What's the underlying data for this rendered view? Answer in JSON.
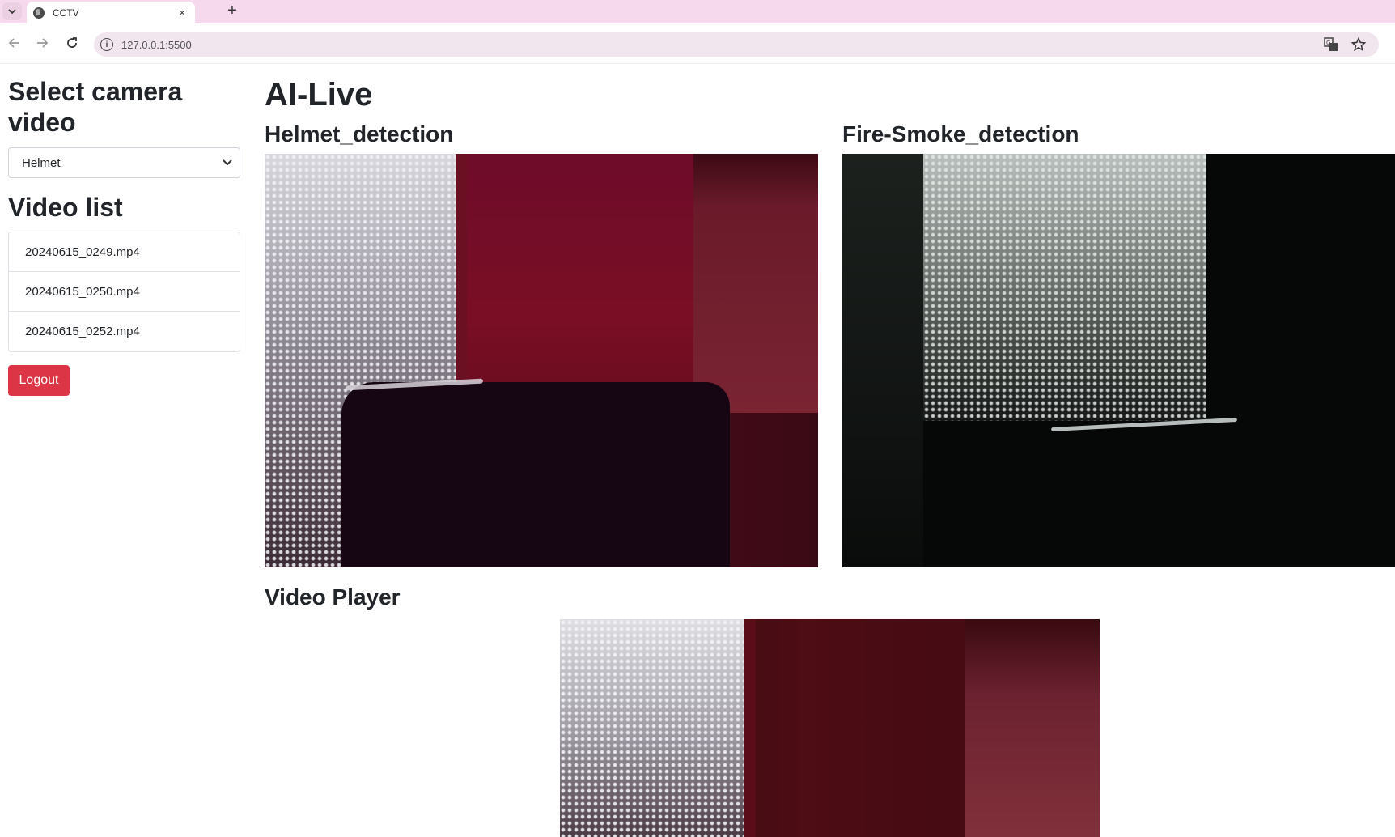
{
  "browser": {
    "tab_title": "CCTV",
    "tab_close": "×",
    "new_tab": "+",
    "url": "127.0.0.1:5500"
  },
  "sidebar": {
    "select_title": "Select camera video",
    "select_value": "Helmet",
    "list_title": "Video list",
    "videos": [
      "20240615_0249.mp4",
      "20240615_0250.mp4",
      "20240615_0252.mp4"
    ],
    "logout_label": "Logout",
    "logout_color": "#dc3545"
  },
  "main": {
    "title": "AI-Live",
    "feeds": [
      {
        "title": "Helmet_detection"
      },
      {
        "title": "Fire-Smoke_detection"
      }
    ],
    "player_title": "Video Player"
  },
  "icons": {
    "tab_search": "chevron-down-icon",
    "favicon": "globe-icon",
    "back": "back-arrow-icon",
    "forward": "forward-arrow-icon",
    "reload": "reload-icon",
    "site_info": "info-icon",
    "translate": "translate-icon",
    "bookmark": "star-icon"
  },
  "colors": {
    "tabstrip": "#f7d9ee",
    "omnibox": "#f1e5ee",
    "danger": "#dc3545"
  }
}
